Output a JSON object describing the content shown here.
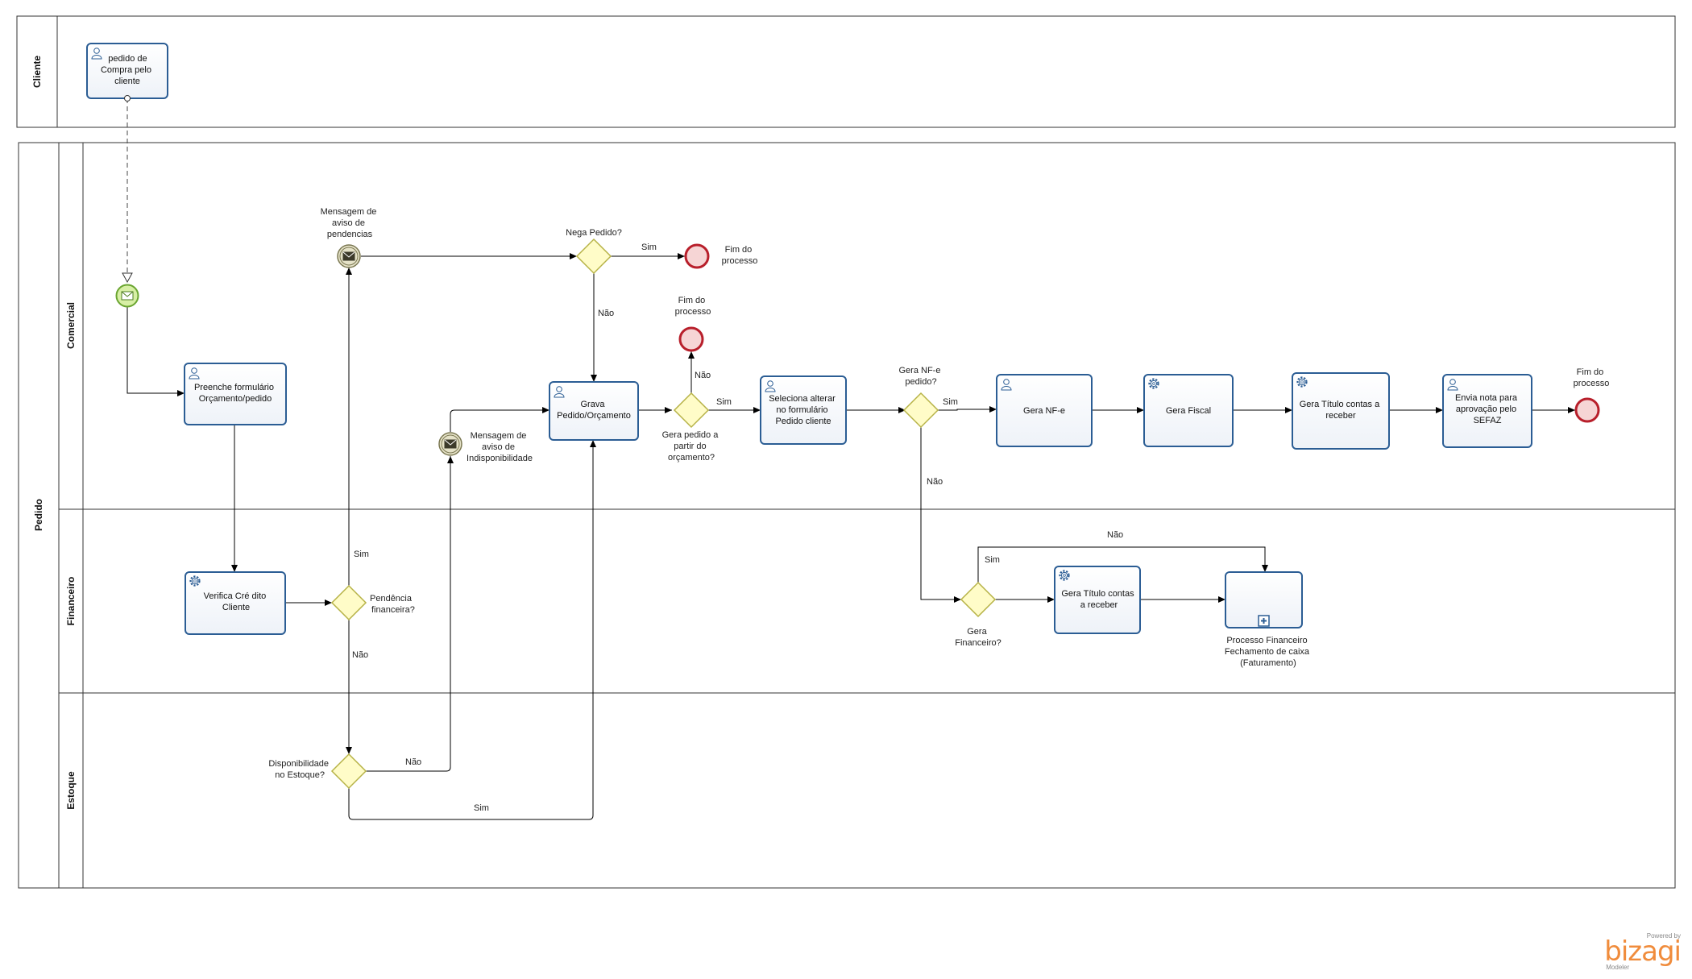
{
  "pools": {
    "cliente": "Cliente",
    "pedido": "Pedido"
  },
  "lanes": {
    "comercial": "Comercial",
    "financeiro": "Financeiro",
    "estoque": "Estoque"
  },
  "tasks": {
    "pedido_compra": [
      "pedido de",
      "Compra pelo",
      "cliente"
    ],
    "preenche": [
      "Preenche formulário",
      "Orçamento/pedido"
    ],
    "verifica": [
      "Verifica Cré dito",
      "Cliente"
    ],
    "grava": [
      "Grava",
      "Pedido/Orçamento"
    ],
    "seleciona": [
      "Seleciona  alterar",
      "no formulário",
      "Pedido cliente"
    ],
    "gera_nfe": [
      "Gera NF-e"
    ],
    "gera_fiscal": [
      "Gera Fiscal"
    ],
    "gera_titulo_1": [
      "Gera Título contas a",
      "receber"
    ],
    "envia_nota": [
      "Envia nota para",
      "aprovação pelo",
      "SEFAZ"
    ],
    "gera_titulo_2": [
      "Gera Título contas",
      "a receber"
    ],
    "processo_fin": [
      "Processo Financeiro",
      "Fechamento de caixa",
      "(Faturamento)"
    ]
  },
  "events": {
    "msg_pendencias": [
      "Mensagem de",
      "aviso de",
      "pendencias"
    ],
    "msg_indisp": [
      "Mensagem de",
      "aviso de",
      "Indisponibilidade"
    ],
    "fim_top": [
      "Fim do",
      "processo"
    ],
    "fim_mid": [
      "Fim do",
      "processo"
    ],
    "fim_right": [
      "Fim do",
      "processo"
    ]
  },
  "gateways": {
    "nega_pedido": [
      "Nega Pedido?"
    ],
    "gera_pedido": [
      "Gera pedido a",
      "partir do",
      "orçamento?"
    ],
    "gera_nfe_q": [
      "Gera NF-e",
      "pedido?"
    ],
    "pendencia": [
      "Pendência",
      "financeira?"
    ],
    "disponibilidade": [
      "Disponibilidade",
      "no Estoque?"
    ],
    "gera_fin": [
      "Gera",
      "Financeiro?"
    ]
  },
  "flow_labels": {
    "sim": "Sim",
    "nao": "Não"
  },
  "brand": {
    "powered": "Powered by",
    "name": "bizagi",
    "product": "Modeler"
  },
  "colors": {
    "task_border": "#2b5d94",
    "gateway_fill": "#fffcc8",
    "gateway_border": "#b7b347",
    "start_fill": "#d7efa5",
    "start_border": "#6aa530",
    "end_fill": "#f6d5d5",
    "end_border": "#b81f2b",
    "inter_fill": "#e5e2c8",
    "inter_border": "#7b7852",
    "brand": "#f08c3c"
  }
}
